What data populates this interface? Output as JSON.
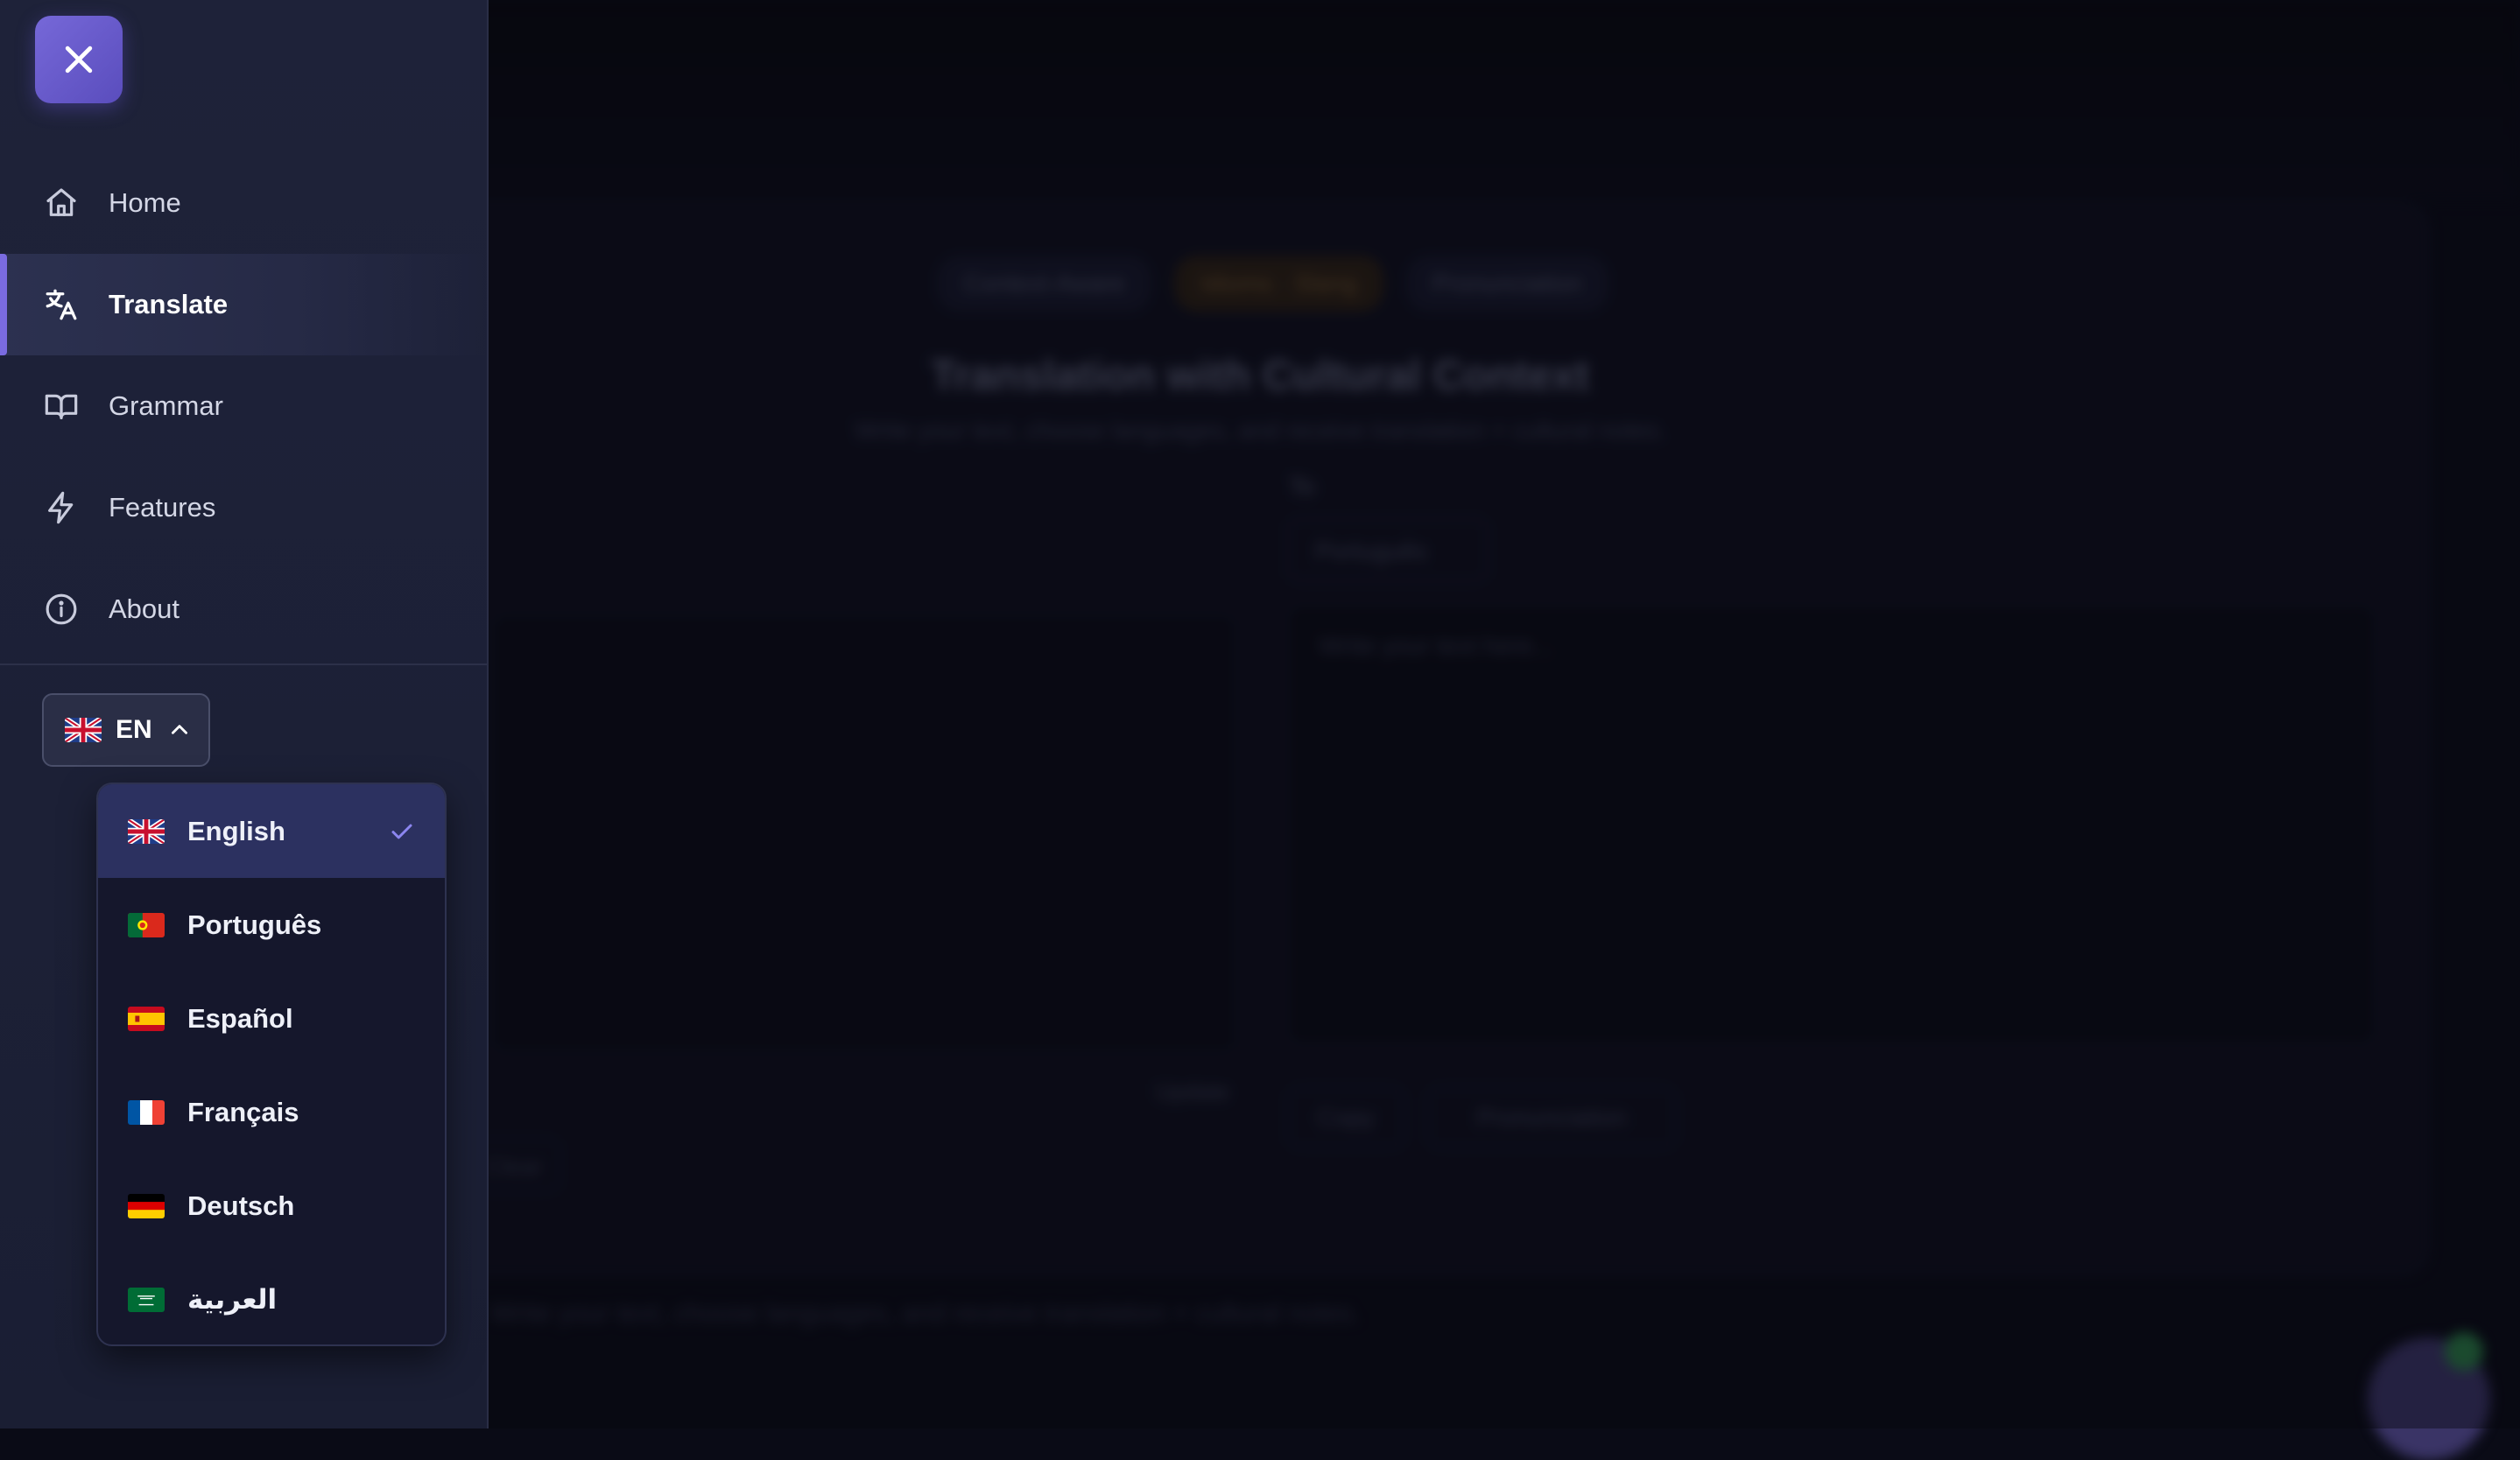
{
  "background": {
    "chips": [
      "Context-Aware",
      "Idioms · Slang",
      "Pronunciation"
    ],
    "title": "Translation with Cultural Context",
    "subtitle": "Write your text, choose languages, and receive translation + cultural notes.",
    "to_label": "To",
    "target_language": "Português",
    "placeholder": "Write your text here...",
    "buttons": [
      "Copy",
      "Pronunciation"
    ],
    "small_label": "Update",
    "left_button": "Clear",
    "footer": "Write your text, choose languages, and receive translation + cultural notes."
  },
  "sidebar": {
    "close_icon": "close-icon",
    "nav": [
      {
        "label": "Home",
        "icon": "home-icon"
      },
      {
        "label": "Translate",
        "icon": "translate-icon",
        "active": true
      },
      {
        "label": "Grammar",
        "icon": "book-icon"
      },
      {
        "label": "Features",
        "icon": "lightning-icon"
      },
      {
        "label": "About",
        "icon": "info-icon"
      }
    ],
    "language_toggle": {
      "code": "EN",
      "flag": "uk-flag"
    },
    "language_options": [
      {
        "label": "English",
        "flag": "uk-flag",
        "selected": true
      },
      {
        "label": "Português",
        "flag": "portugal-flag"
      },
      {
        "label": "Español",
        "flag": "spain-flag"
      },
      {
        "label": "Français",
        "flag": "france-flag"
      },
      {
        "label": "Deutsch",
        "flag": "germany-flag"
      },
      {
        "label": "العربية",
        "flag": "saudi-flag"
      }
    ]
  },
  "colors": {
    "accent": "#7668d8",
    "sidebar_bg": "#1e2239",
    "selected_option": "#2c3160"
  }
}
